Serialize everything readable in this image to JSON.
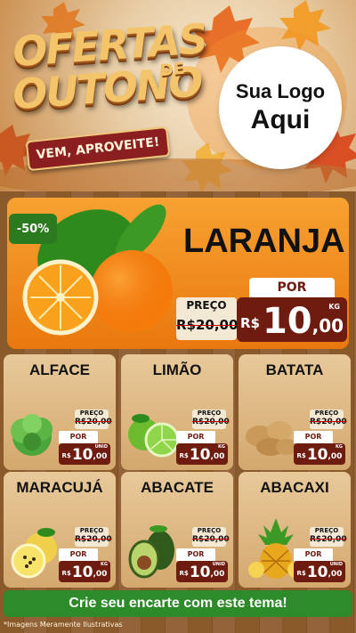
{
  "header": {
    "title_line1": "OFERTAS",
    "title_de": "DE",
    "title_line2": "OUTONO",
    "ribbon": "VEM, APROVEITE!",
    "logo_line1": "Sua Logo",
    "logo_line2": "Aqui"
  },
  "featured": {
    "discount_badge": "-50%",
    "name": "LARANJA",
    "old_label": "PREÇO",
    "old_price": "R$20,00",
    "new_label": "POR",
    "currency": "R$",
    "price_int": "10",
    "price_dec": ",00",
    "unit": "KG"
  },
  "products": [
    {
      "name": "ALFACE",
      "old_label": "PREÇO",
      "old_price": "R$20,00",
      "new_label": "POR",
      "currency": "R$",
      "price_int": "10",
      "price_dec": ",00",
      "unit": "UNID"
    },
    {
      "name": "LIMÃO",
      "old_label": "PREÇO",
      "old_price": "R$20,00",
      "new_label": "POR",
      "currency": "R$",
      "price_int": "10",
      "price_dec": ",00",
      "unit": "KG"
    },
    {
      "name": "BATATA",
      "old_label": "PREÇO",
      "old_price": "R$20,00",
      "new_label": "POR",
      "currency": "R$",
      "price_int": "10",
      "price_dec": ",00",
      "unit": "KG"
    },
    {
      "name": "MARACUJÁ",
      "old_label": "PREÇO",
      "old_price": "R$20,00",
      "new_label": "POR",
      "currency": "R$",
      "price_int": "10",
      "price_dec": ",00",
      "unit": "KG"
    },
    {
      "name": "ABACATE",
      "old_label": "PREÇO",
      "old_price": "R$20,00",
      "new_label": "POR",
      "currency": "R$",
      "price_int": "10",
      "price_dec": ",00",
      "unit": "UNID"
    },
    {
      "name": "ABACAXI",
      "old_label": "PREÇO",
      "old_price": "R$20,00",
      "new_label": "POR",
      "currency": "R$",
      "price_int": "10",
      "price_dec": ",00",
      "unit": "UNID"
    }
  ],
  "cta": "Crie seu encarte com este tema!",
  "footnote": "*Imagens Meramente Ilustrativas",
  "colors": {
    "orange": "#f08a1c",
    "wine": "#6e1b10",
    "green": "#2e8b2a"
  }
}
